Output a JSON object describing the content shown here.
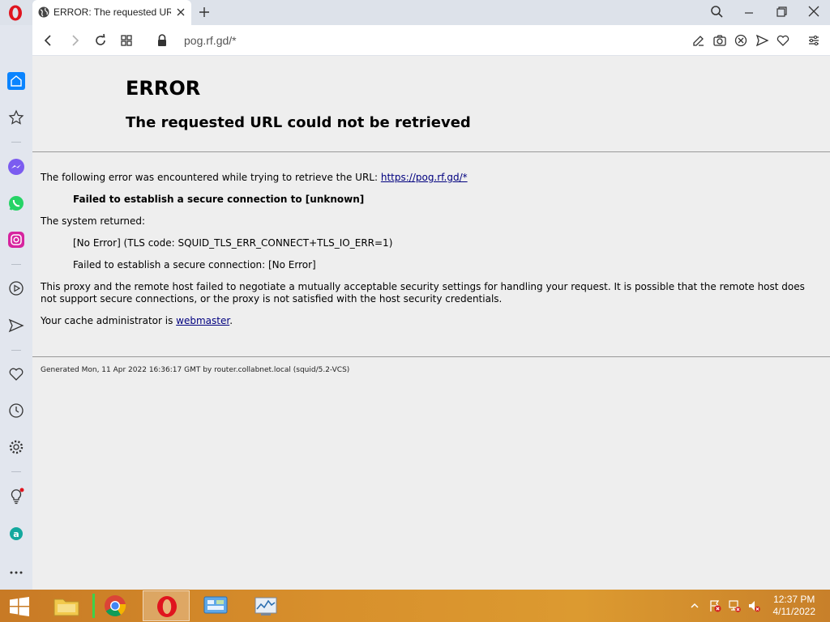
{
  "browser": {
    "tab_title": "ERROR: The requested URL",
    "url": "pog.rf.gd/*"
  },
  "page": {
    "heading": "ERROR",
    "subheading": "The requested URL could not be retrieved",
    "intro_text": "The following error was encountered while trying to retrieve the URL: ",
    "intro_link": "https://pog.rf.gd/*",
    "error_main": "Failed to establish a secure connection to [unknown]",
    "system_returned": "The system returned:",
    "tls_code": "[No Error] (TLS code: SQUID_TLS_ERR_CONNECT+TLS_IO_ERR=1)",
    "secure_conn_error": "Failed to establish a secure connection: [No Error]",
    "proxy_explanation": "This proxy and the remote host failed to negotiate a mutually acceptable security settings for handling your request. It is possible that the remote host does not support secure connections, or the proxy is not satisfied with the host security credentials.",
    "admin_text": "Your cache administrator is ",
    "admin_link": "webmaster",
    "admin_suffix": ".",
    "footer": "Generated Mon, 11 Apr 2022 16:36:17 GMT by router.collabnet.local (squid/5.2-VCS)"
  },
  "taskbar": {
    "time": "12:37 PM",
    "date": "4/11/2022"
  },
  "colors": {
    "opera_red": "#e0141e",
    "sidebar_active": "#0a84ff",
    "link": "#00007f"
  }
}
